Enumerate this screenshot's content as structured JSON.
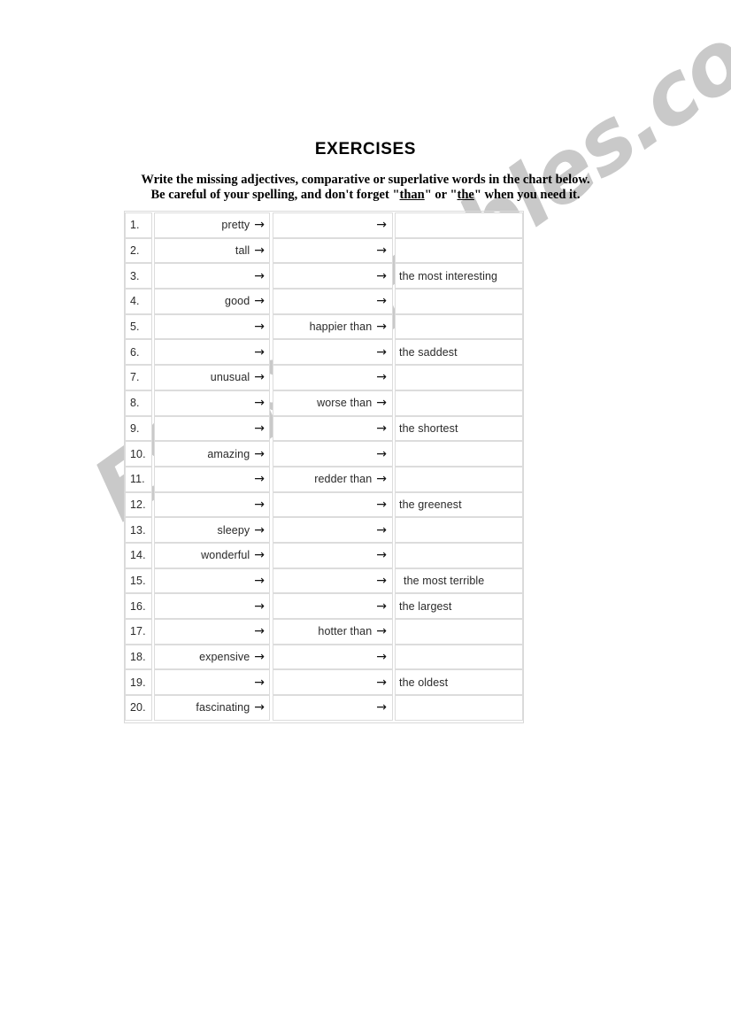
{
  "page": {
    "title": "EXERCISES",
    "instructions": {
      "line1_a": "Write the missing adjectives, comparative or superlative words in the chart below.",
      "line2_a": "Be careful of your spelling, and don't forget \"",
      "line2_u1": "than",
      "line2_b": "\" or \"",
      "line2_u2": "the",
      "line2_c": "\" when you need it."
    },
    "watermark": {
      "text": "ESLprintables.com",
      "color": "#c9c9c9"
    }
  },
  "chart": {
    "arrow_glyph": "→",
    "rows": [
      {
        "num": "1.",
        "adjective": "pretty",
        "comparative": "",
        "superlative": ""
      },
      {
        "num": "2.",
        "adjective": "tall",
        "comparative": "",
        "superlative": ""
      },
      {
        "num": "3.",
        "adjective": "",
        "comparative": "",
        "superlative": "the most interesting"
      },
      {
        "num": "4.",
        "adjective": "good",
        "comparative": "",
        "superlative": ""
      },
      {
        "num": "5.",
        "adjective": "",
        "comparative": "happier than",
        "superlative": ""
      },
      {
        "num": "6.",
        "adjective": "",
        "comparative": "",
        "superlative": "the saddest"
      },
      {
        "num": "7.",
        "adjective": "unusual",
        "comparative": "",
        "superlative": ""
      },
      {
        "num": "8.",
        "adjective": "",
        "comparative": "worse than",
        "superlative": ""
      },
      {
        "num": "9.",
        "adjective": "",
        "comparative": "",
        "superlative": "the shortest"
      },
      {
        "num": "10.",
        "adjective": "amazing",
        "comparative": "",
        "superlative": ""
      },
      {
        "num": "11.",
        "adjective": "",
        "comparative": "redder than",
        "superlative": ""
      },
      {
        "num": "12.",
        "adjective": "",
        "comparative": "",
        "superlative": "the greenest"
      },
      {
        "num": "13.",
        "adjective": "sleepy",
        "comparative": "",
        "superlative": ""
      },
      {
        "num": "14.",
        "adjective": "wonderful",
        "comparative": "",
        "superlative": ""
      },
      {
        "num": "15.",
        "adjective": "",
        "comparative": "",
        "superlative": "the most terrible"
      },
      {
        "num": "16.",
        "adjective": "",
        "comparative": "",
        "superlative": "the largest"
      },
      {
        "num": "17.",
        "adjective": "",
        "comparative": "hotter than",
        "superlative": ""
      },
      {
        "num": "18.",
        "adjective": "expensive",
        "comparative": "",
        "superlative": ""
      },
      {
        "num": "19.",
        "adjective": "",
        "comparative": "",
        "superlative": "the oldest"
      },
      {
        "num": "20.",
        "adjective": "fascinating",
        "comparative": "",
        "superlative": ""
      }
    ]
  }
}
